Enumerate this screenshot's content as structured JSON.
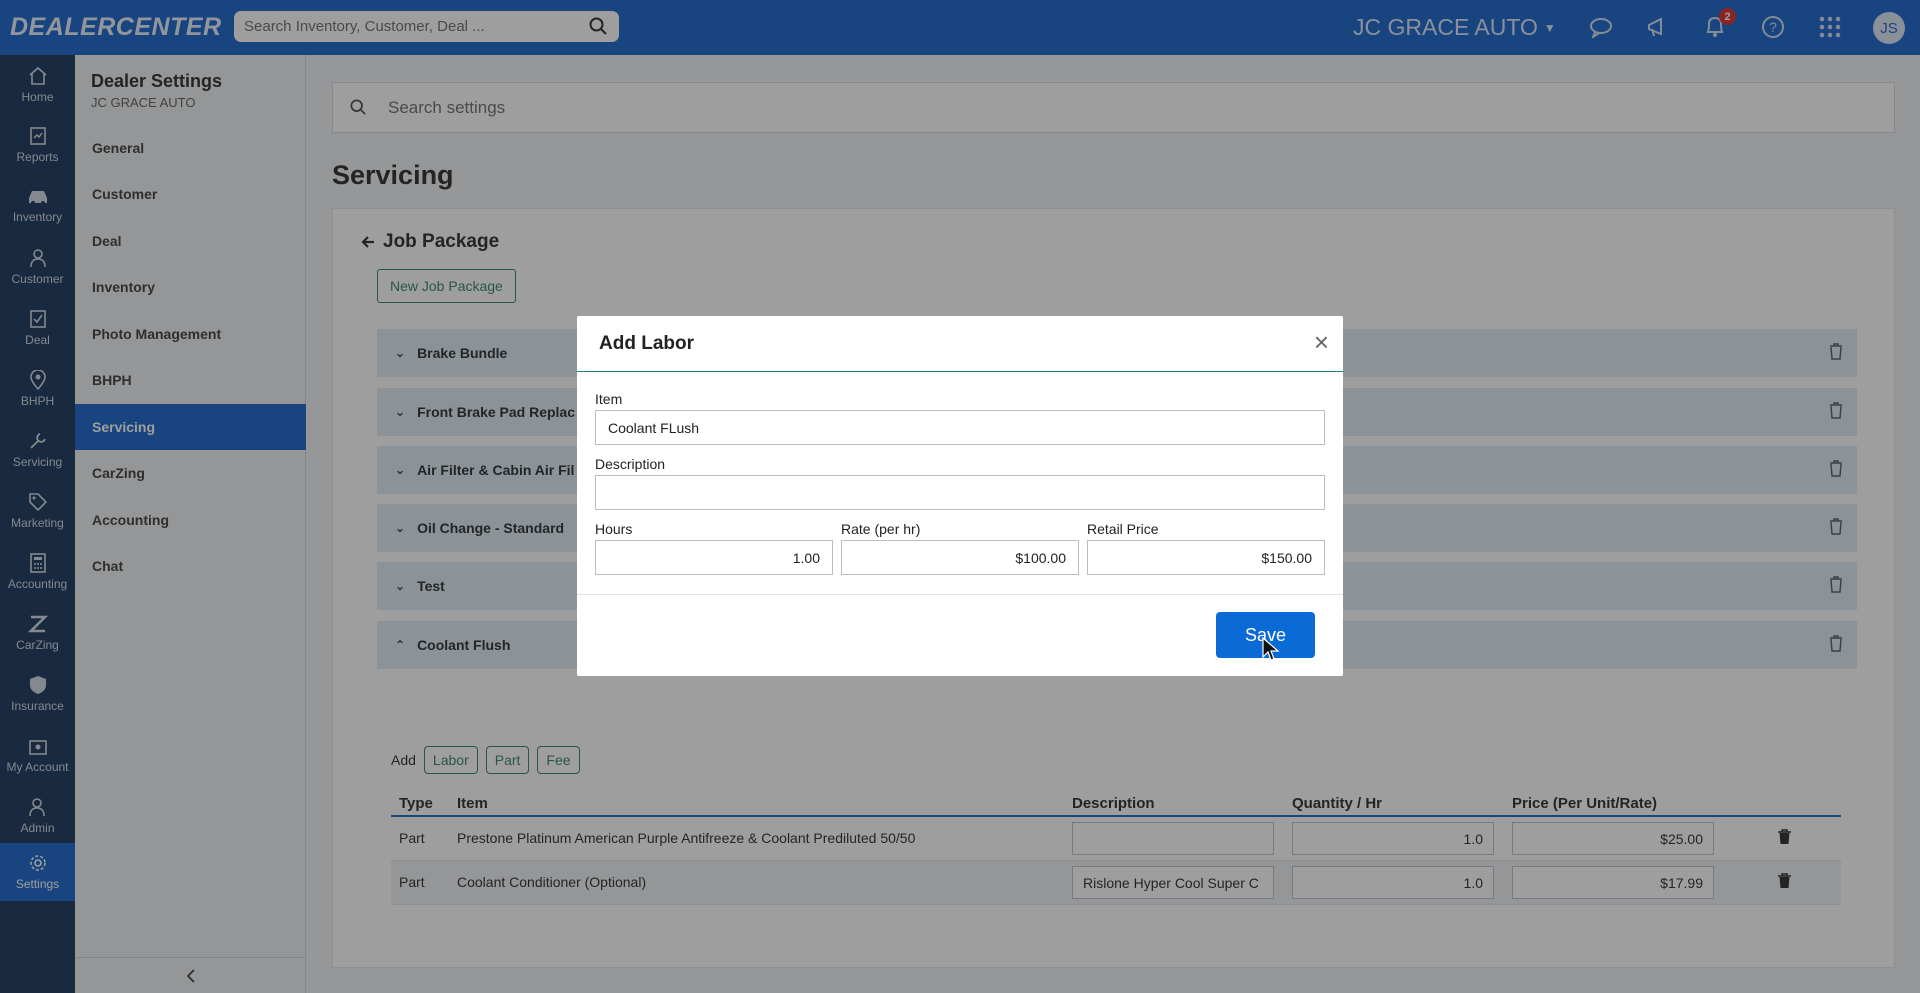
{
  "topbar": {
    "logo": "DEALERCENTER",
    "search_placeholder": "Search Inventory, Customer, Deal ...",
    "dealer": "JC GRACE AUTO",
    "notifications_count": "2",
    "avatar": "JS"
  },
  "rail": [
    {
      "label": "Home",
      "icon": "home-icon"
    },
    {
      "label": "Reports",
      "icon": "reports-icon"
    },
    {
      "label": "Inventory",
      "icon": "car-icon"
    },
    {
      "label": "Customer",
      "icon": "person-icon"
    },
    {
      "label": "Deal",
      "icon": "deal-icon"
    },
    {
      "label": "BHPH",
      "icon": "map-pin-icon"
    },
    {
      "label": "Servicing",
      "icon": "wrench-icon"
    },
    {
      "label": "Marketing",
      "icon": "tag-icon"
    },
    {
      "label": "Accounting",
      "icon": "calculator-icon"
    },
    {
      "label": "CarZing",
      "icon": "carzing-icon"
    },
    {
      "label": "Insurance",
      "icon": "shield-icon"
    },
    {
      "label": "My Account",
      "icon": "account-icon"
    },
    {
      "label": "Admin",
      "icon": "admin-icon"
    },
    {
      "label": "Settings",
      "icon": "gear-icon"
    }
  ],
  "subnav": {
    "title": "Dealer Settings",
    "subtitle": "JC GRACE AUTO",
    "items": [
      "General",
      "Customer",
      "Deal",
      "Inventory",
      "Photo Management",
      "BHPH",
      "Servicing",
      "CarZing",
      "Accounting",
      "Chat"
    ],
    "active": "Servicing"
  },
  "main": {
    "search_placeholder": "Search settings",
    "page_title": "Servicing",
    "back_title": "Job Package",
    "new_button": "New Job Package",
    "packages": [
      "Brake Bundle",
      "Front Brake Pad Replac",
      "Air Filter & Cabin Air Fil",
      "Oil Change - Standard",
      "Test",
      "Coolant Flush"
    ],
    "add_label": "Add",
    "add_buttons": [
      "Labor",
      "Part",
      "Fee"
    ],
    "table": {
      "headers": [
        "Type",
        "Item",
        "Description",
        "Quantity / Hr",
        "Price (Per Unit/Rate)"
      ],
      "rows": [
        {
          "type": "Part",
          "item": "Prestone Platinum American Purple Antifreeze & Coolant Prediluted 50/50",
          "description": "",
          "qty": "1.0",
          "price": "$25.00"
        },
        {
          "type": "Part",
          "item": "Coolant Conditioner (Optional)",
          "description": "Rislone Hyper Cool Super C",
          "qty": "1.0",
          "price": "$17.99"
        }
      ]
    }
  },
  "modal": {
    "title": "Add Labor",
    "item_label": "Item",
    "item_value": "Coolant FLush",
    "description_label": "Description",
    "description_value": "",
    "hours_label": "Hours",
    "hours_value": "1.00",
    "rate_label": "Rate (per hr)",
    "rate_value": "$100.00",
    "retail_label": "Retail Price",
    "retail_value": "$150.00",
    "save_label": "Save"
  }
}
